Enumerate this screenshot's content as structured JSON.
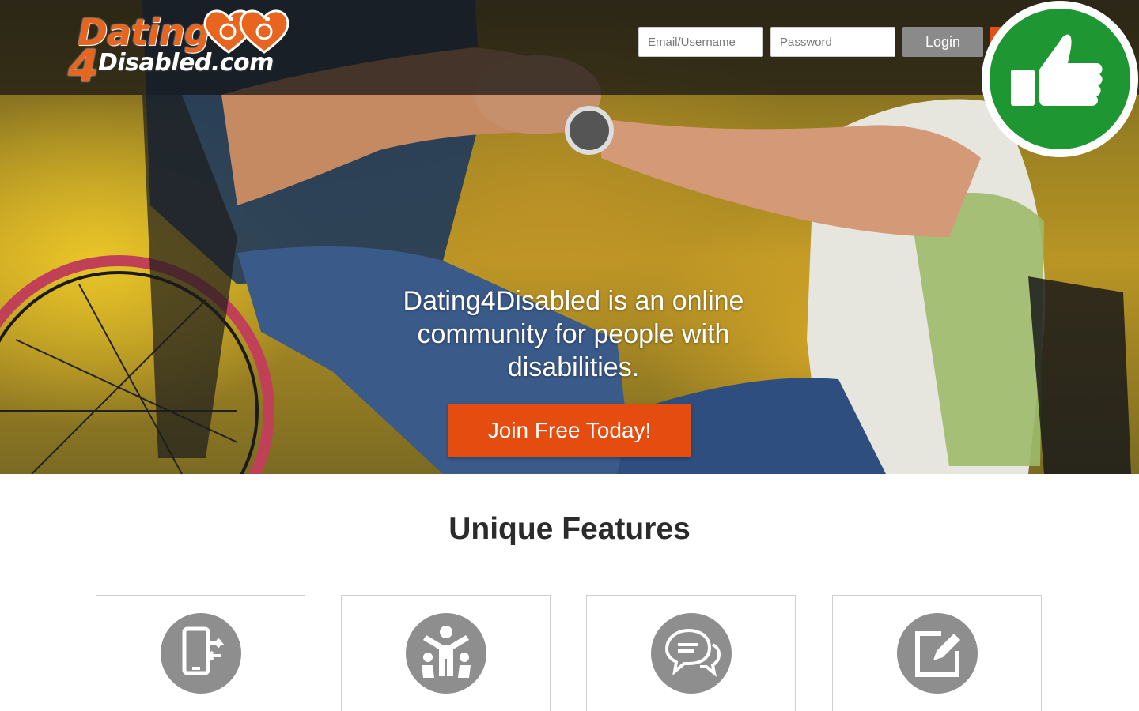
{
  "brand": {
    "logo_top": "Dating",
    "logo_digit": "4",
    "logo_bottom": "Disabled.com"
  },
  "login": {
    "email_placeholder": "Email/Username",
    "password_placeholder": "Password",
    "login_label": "Login"
  },
  "hero": {
    "tagline": "Dating4Disabled is an online community for people with disabilities.",
    "cta_label": "Join Free Today!"
  },
  "badge": {
    "icon": "thumbs-up-icon",
    "color": "#1e9632"
  },
  "features": {
    "title": "Unique Features",
    "items": [
      {
        "icon": "mobile-transfer-icon"
      },
      {
        "icon": "community-people-icon"
      },
      {
        "icon": "chat-bubbles-icon"
      },
      {
        "icon": "edit-note-icon"
      }
    ]
  },
  "colors": {
    "accent": "#e54c0f",
    "logo_orange": "#e8651f",
    "icon_gray": "#8e8e8e",
    "topbar": "#141414"
  }
}
